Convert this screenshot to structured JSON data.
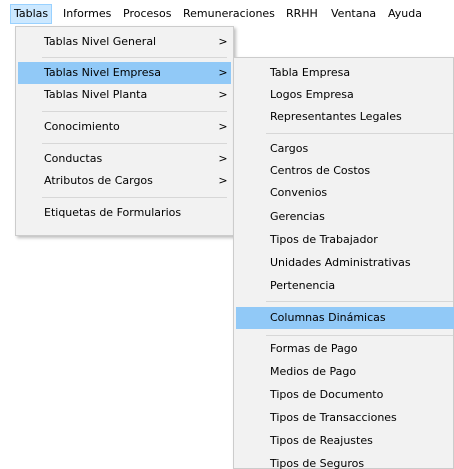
{
  "menubar": {
    "items": [
      "Tablas",
      "Informes",
      "Procesos",
      "Remuneraciones",
      "RRHH",
      "Ventana",
      "Ayuda"
    ]
  },
  "tablas_menu": {
    "items": [
      "Tablas Nivel General",
      "Tablas Nivel Empresa",
      "Tablas Nivel Planta",
      "Conocimiento",
      "Conductas",
      "Atributos de Cargos",
      "Etiquetas de Formularios"
    ],
    "submenu_arrow": ">"
  },
  "empresa_menu": {
    "items": [
      "Tabla Empresa",
      "Logos Empresa",
      "Representantes Legales",
      "Cargos",
      "Centros de Costos",
      "Convenios",
      "Gerencias",
      "Tipos de Trabajador",
      "Unidades Administrativas",
      "Pertenencia",
      "Columnas Dinámicas",
      "Formas de Pago",
      "Medios de Pago",
      "Tipos de Documento",
      "Tipos de Transacciones",
      "Tipos de Reajustes",
      "Tipos de Seguros"
    ]
  },
  "colors": {
    "menu_bg": "#f2f2f2",
    "highlight": "#91c9f7",
    "menubar_active": "#cce8ff"
  }
}
